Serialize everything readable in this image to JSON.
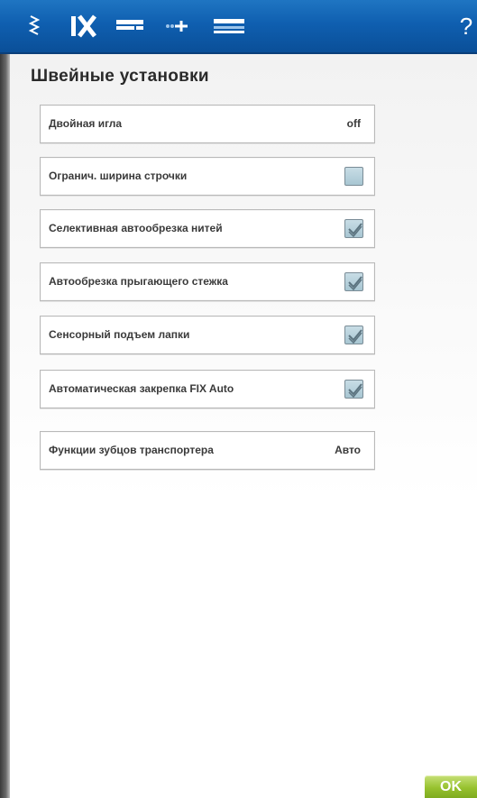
{
  "toolbar": {
    "icons": [
      "stitch-icon",
      "fix-icon",
      "presser-foot-icon",
      "thread-tension-icon",
      "bobbin-icon",
      "help-icon"
    ],
    "help_label": "?"
  },
  "page": {
    "title": "Швейные установки"
  },
  "settings": [
    {
      "label": "Двойная игла",
      "control": "value",
      "value": "off"
    },
    {
      "label": "Огранич. ширина строчки",
      "control": "checkbox",
      "checked": false
    },
    {
      "label": "Селективная автообрезка нитей",
      "control": "checkbox",
      "checked": true
    },
    {
      "label": "Автообрезка прыгающего стежка",
      "control": "checkbox",
      "checked": true
    },
    {
      "label": "Сенсорный подъем лапки",
      "control": "checkbox",
      "checked": true
    },
    {
      "label": "Автоматическая закрепка FIX Auto",
      "control": "checkbox",
      "checked": true
    },
    {
      "label": "Функции зубцов транспортера",
      "control": "value",
      "value": "Авто"
    }
  ],
  "footer": {
    "ok_label": "OK"
  },
  "colors": {
    "toolbar_blue": "#0f5fb0",
    "ok_green": "#97c22f",
    "checkbox_fill": "#a8c6d2"
  }
}
